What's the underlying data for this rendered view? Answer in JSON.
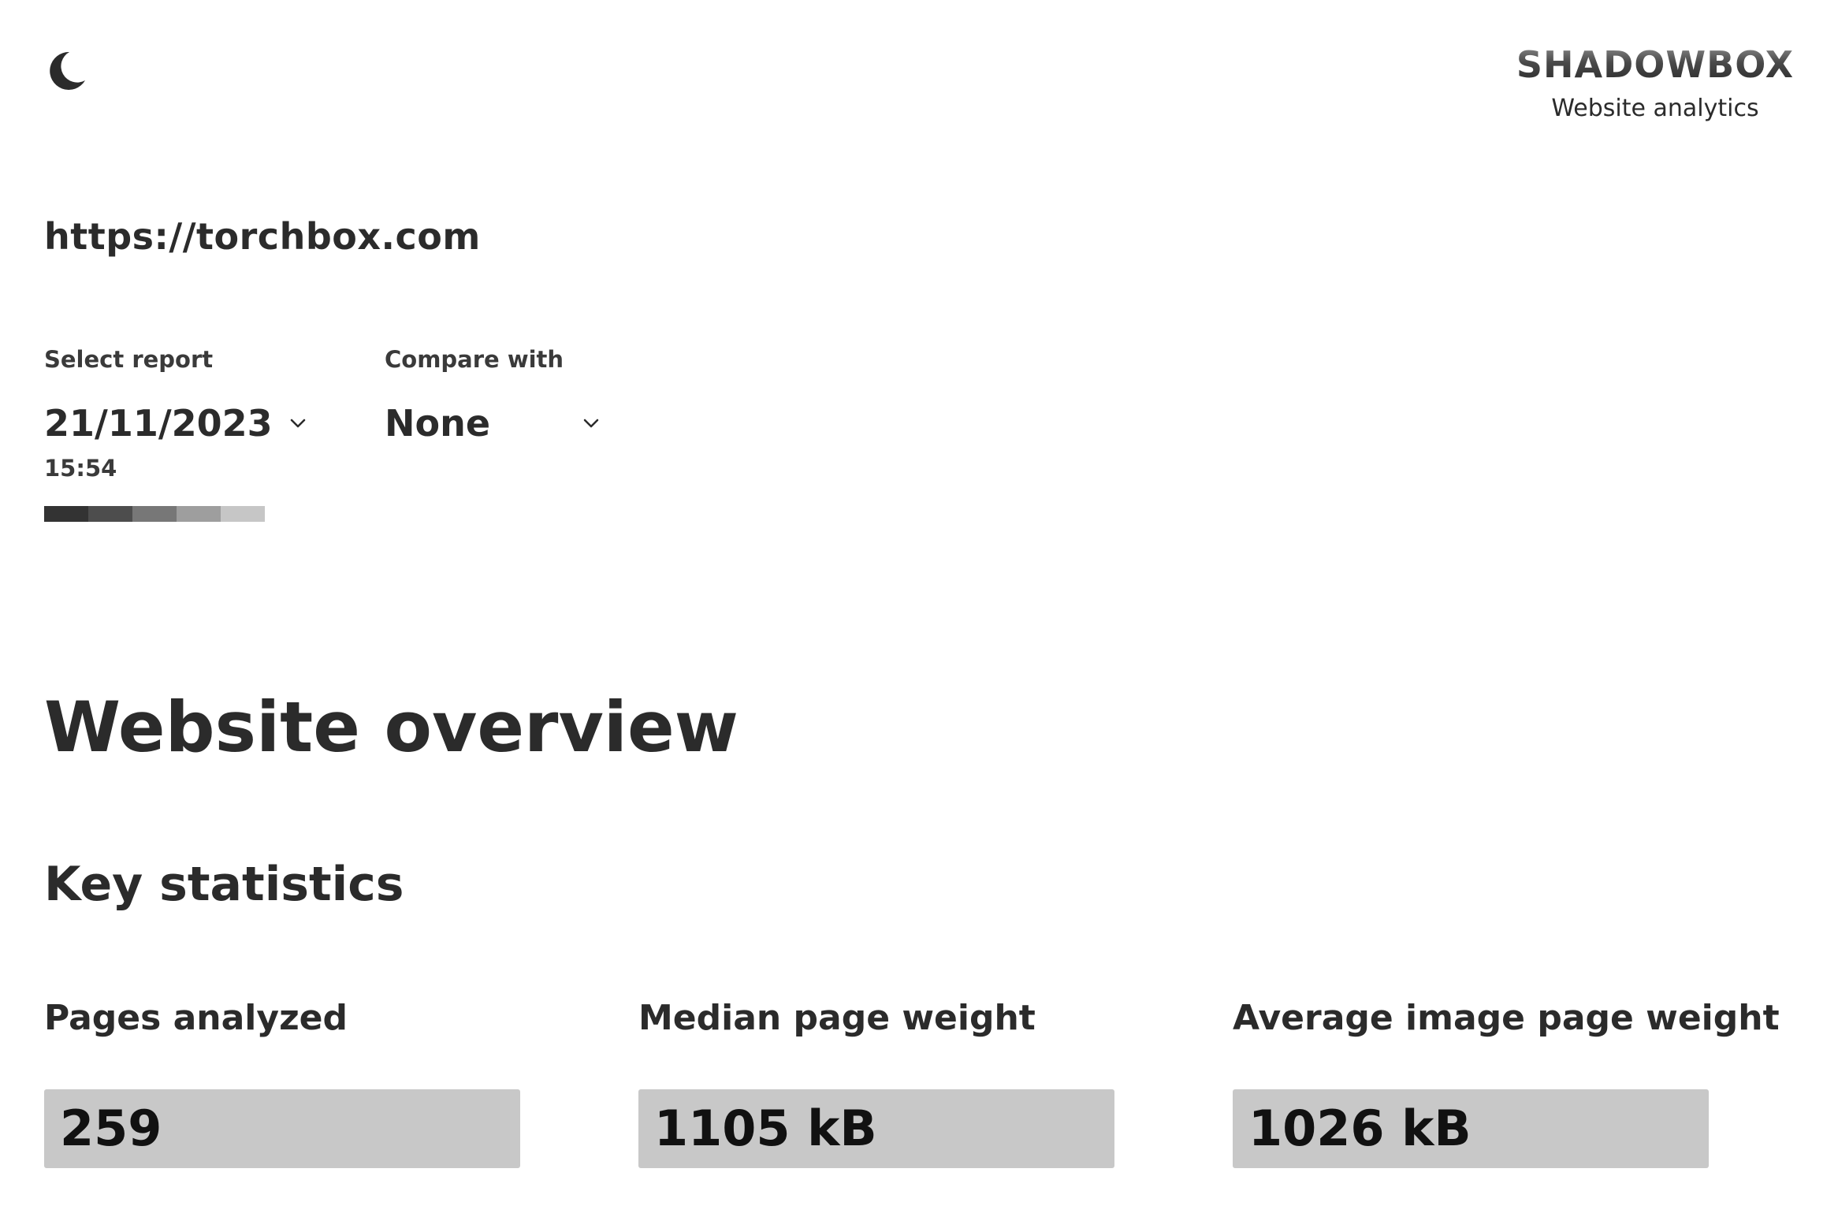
{
  "header": {
    "theme_toggle_icon": "moon-icon",
    "brand_name": "SHADOWBOX",
    "brand_tagline": "Website analytics"
  },
  "site": {
    "url": "https://torchbox.com"
  },
  "report_selector": {
    "label": "Select report",
    "value": "21/11/2023",
    "time": "15:54",
    "icon": "chevron-down-icon"
  },
  "compare_selector": {
    "label": "Compare with",
    "value": "None",
    "icon": "chevron-down-icon"
  },
  "swatches": [
    "#333333",
    "#4d4d4d",
    "#777777",
    "#9e9e9e",
    "#c6c6c6"
  ],
  "overview": {
    "title": "Website overview"
  },
  "key_statistics": {
    "title": "Key statistics",
    "items": [
      {
        "label": "Pages analyzed",
        "value": "259"
      },
      {
        "label": "Median page weight",
        "value": "1105 kB"
      },
      {
        "label": "Average image page weight",
        "value": "1026 kB"
      }
    ]
  },
  "colors": {
    "text": "#2b2b2b",
    "stat_box_background": "#c8c8c8",
    "background": "#ffffff"
  }
}
